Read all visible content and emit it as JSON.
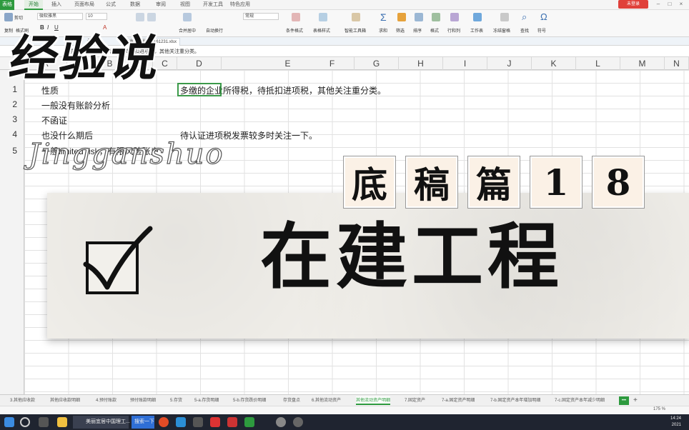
{
  "app": {
    "logo": "表格",
    "menus": [
      "开始",
      "插入",
      "页面布局",
      "公式",
      "数据",
      "审阅",
      "视图",
      "开发工具",
      "特色应用"
    ],
    "active_menu": "开始",
    "login_label": "未登录"
  },
  "ribbon": {
    "paste_label": "剪切",
    "copy_label": "复制",
    "format_painter_label": "格式刷",
    "font_name": "微软雅黑",
    "font_size": "10",
    "merge_label": "合并居中",
    "wrap_label": "自动换行",
    "number_format": "常规",
    "cond_format_label": "条件格式",
    "table_style_label": "表格样式",
    "smart_toolbox_label": "智能工具箱",
    "sum_label": "求和",
    "filter_label": "筛选",
    "sort_label": "排序",
    "format_label": "格式",
    "rowcol_label": "行和列",
    "worksheet_label": "工作表",
    "freeze_label": "冻结窗格",
    "find_label": "查找",
    "symbol_label": "符号"
  },
  "doc_tabs": [
    "云文档",
    "审计底稿_20161231.xlsx"
  ],
  "formula_bar": {
    "fx": "fx",
    "content": "性质：多缴的企业所得税，待抵扣进项税，其他关注重分类。"
  },
  "columns": [
    "A",
    "B",
    "C",
    "D",
    "E",
    "F",
    "G",
    "H",
    "I",
    "J",
    "K",
    "L",
    "M",
    "N"
  ],
  "rows": [
    "1",
    "2",
    "3",
    "4",
    "5"
  ],
  "cells": {
    "r1_left": "性质",
    "r1_right": "多缴的企业所得税，待抵扣进项税，其他关注重分类。",
    "r2_left": "一般没有账龄分析",
    "r3_left": "不函证",
    "r4_left": "也没什么期后",
    "r4_right": "待认证进项税发票较多时关注一下。",
    "r5_left": "一般limited risk，有限风险账户"
  },
  "overlay": {
    "brand": "经验说",
    "pinyin": "Jingganshuo",
    "episode_chars": [
      "底",
      "稿",
      "篇",
      "1",
      "8"
    ],
    "title": "在建工程"
  },
  "sheet_tabs": [
    "3.其他应收款",
    "其他应收款明细",
    "4.预付账款",
    "预付账款明细",
    "5.存货",
    "5-a.存货明细",
    "5-b.存货跌价明细",
    "存货盘点",
    "6.其他流动资产",
    "其他流动资产明细",
    "7.固定资产",
    "7-a.固定资产明细",
    "7-b.固定资产本年增加明细",
    "7-c.固定资产本年减少明细"
  ],
  "active_sheet": "其他流动资产明细",
  "status": {
    "zoom": "175 %"
  },
  "taskbar": {
    "apps": [
      "美丽宜居中国理工...",
      "搜索一下"
    ],
    "time": "14:24",
    "date": "2021"
  },
  "colors": {
    "accent": "#2d9a3e",
    "login": "#e0403a",
    "banner": "#f2f0eb",
    "episode_box": "#fbf1e6"
  }
}
